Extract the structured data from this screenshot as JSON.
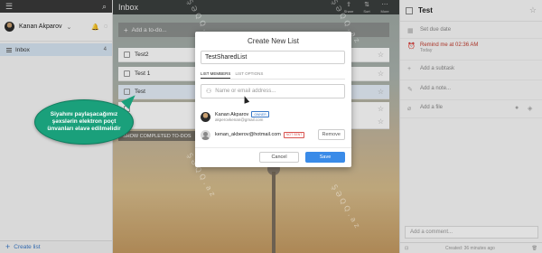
{
  "sidebar": {
    "user_name": "Kanan Akparov",
    "inbox": {
      "label": "Inbox",
      "count": "4"
    },
    "create_list": "Create list"
  },
  "main": {
    "title": "Inbox",
    "toolbar": [
      {
        "label": "Share",
        "icon": "share-icon"
      },
      {
        "label": "Sort",
        "icon": "sort-icon"
      },
      {
        "label": "More",
        "icon": "more-icon"
      }
    ],
    "add_todo_placeholder": "Add a to-do...",
    "tasks": [
      "Test2",
      "Test 1",
      "Test",
      "",
      ""
    ],
    "completed_label": "SHOW COMPLETED TO-DOS"
  },
  "detail": {
    "title": "Test",
    "due_date": "Set due date",
    "reminder": "Remind me at 02:36 AM",
    "reminder_sub": "Today",
    "subtask": "Add a subtask",
    "note": "Add a note...",
    "file": "Add a file",
    "comment_placeholder": "Add a comment...",
    "created": "Created: 36 minutes ago"
  },
  "modal": {
    "title": "Create New List",
    "list_name": "TestSharedList",
    "tab_members": "LIST MEMBERS",
    "tab_options": "LIST OPTIONS",
    "email_placeholder": "Name or email address...",
    "members": [
      {
        "name": "Kanan Akparov",
        "email": "akperovkenan@gmail.com",
        "badge": "OWNER"
      },
      {
        "name": "kenan_akberov@hotmail.com",
        "badge": "NOT SENT",
        "action": "Remove"
      }
    ],
    "cancel": "Cancel",
    "save": "Save"
  },
  "callout": {
    "text": "Siyahını paylaşacağımız\nşəxslərin elektron poçt\nünvanları əlavə edilməlidir"
  },
  "watermark": "ŞƏQQ.az"
}
